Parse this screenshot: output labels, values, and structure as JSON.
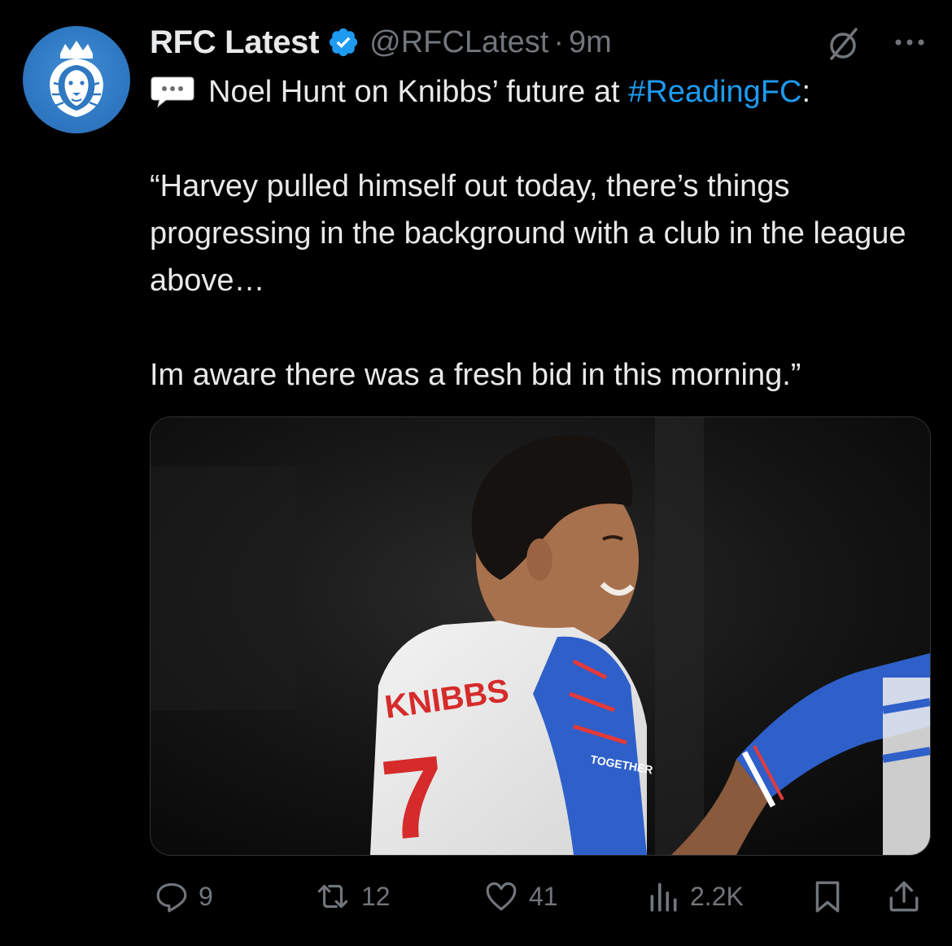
{
  "tweet": {
    "display_name": "RFC Latest",
    "handle": "@RFCLatest",
    "separator": "·",
    "time": "9m",
    "verified": true,
    "verified_color": "#1d9bf0",
    "avatar_icon": "lion-crest-icon",
    "text": {
      "intro_before_tag": "Noel Hunt on Knibbs’ future at ",
      "hashtag": "#ReadingFC",
      "intro_after_tag": ":",
      "quote_line_1": "“Harvey pulled himself out today, there’s things progressing in the background with a club in the league above…",
      "quote_line_2": "Im aware there was a fresh bid in this morning.”"
    },
    "hashtag_color": "#1d9bf0"
  },
  "media": {
    "jersey_name": "KNIBBS",
    "jersey_number": "7",
    "sleeve_text": "TOGETHER"
  },
  "actions": {
    "replies": "9",
    "reposts": "12",
    "likes": "41",
    "views": "2.2K"
  }
}
